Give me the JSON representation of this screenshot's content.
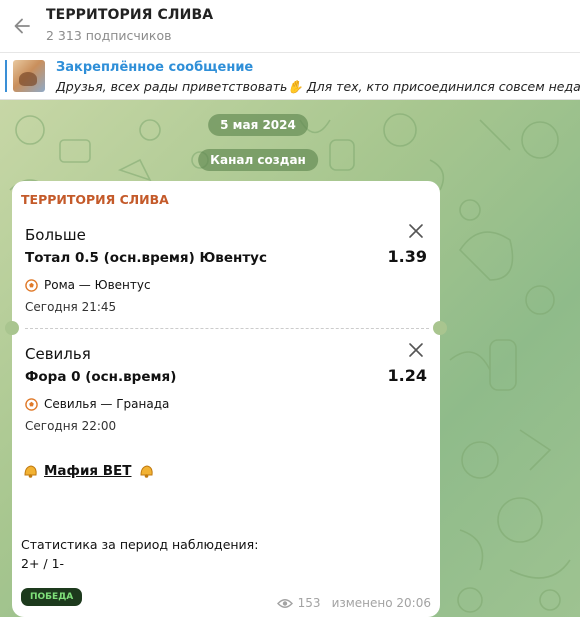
{
  "header": {
    "title": "ТЕРРИТОРИЯ СЛИВА",
    "subscribers": "2 313 подписчиков"
  },
  "pinned": {
    "title": "Закреплённое сообщение",
    "text": "Друзья, всех рады приветствовать✋  Для тех, кто присоединился совсем недавно,"
  },
  "chat": {
    "date_pill": "5 мая 2024",
    "service_pill": "Канал создан"
  },
  "message": {
    "channel_name": "ТЕРРИТОРИЯ СЛИВА",
    "bets": [
      {
        "market": "Больше",
        "selection": "Тотал 0.5 (осн.время) Ювентус",
        "odds": "1.39",
        "match": "Рома — Ювентус",
        "time": "Сегодня 21:45"
      },
      {
        "market": "Севилья",
        "selection": "Фора 0 (осн.время)",
        "odds": "1.24",
        "match": "Севилья — Гранада",
        "time": "Сегодня 22:00"
      }
    ],
    "promo_label": "Мафия BET",
    "stats_title": "Статистика за период наблюдения:",
    "stats_value": "2+ / 1-",
    "badge": "ПОБЕДА",
    "views": "153",
    "edited": "изменено 20:06"
  },
  "colors": {
    "accent": "#2f8fd8",
    "channel_name": "#c45a2a",
    "badge_bg": "#1d3a1d",
    "badge_text": "#7fe07a"
  },
  "icons": [
    "back-arrow-icon",
    "close-icon",
    "soccer-ball-icon",
    "bell-icon",
    "eye-icon"
  ]
}
